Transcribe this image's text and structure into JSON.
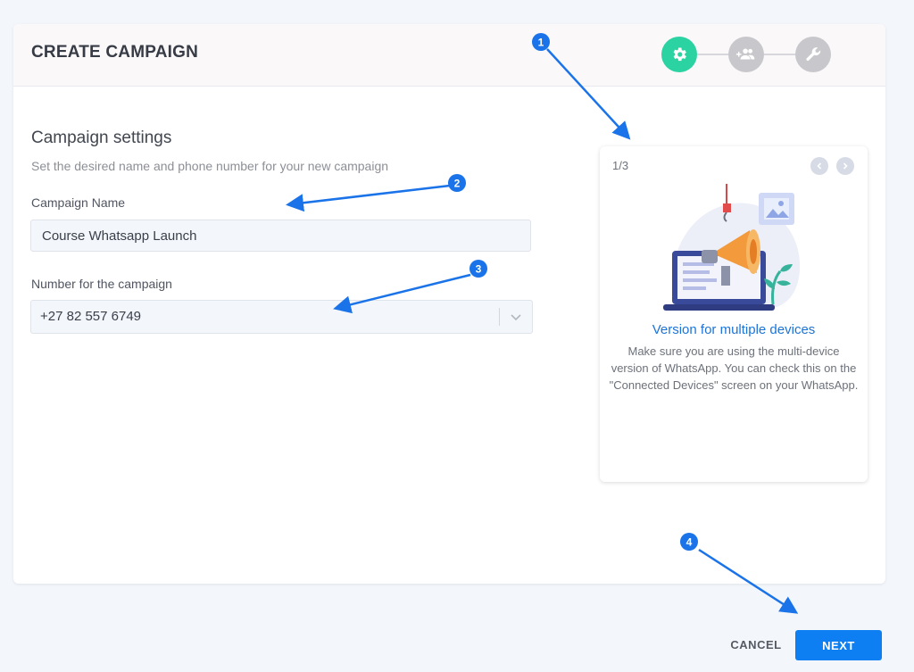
{
  "header": {
    "title": "CREATE CAMPAIGN",
    "steps": [
      {
        "icon": "gear-icon",
        "active": true
      },
      {
        "icon": "add-group-icon",
        "active": false
      },
      {
        "icon": "wrench-icon",
        "active": false
      }
    ]
  },
  "form": {
    "section_title": "Campaign settings",
    "section_subtitle": "Set the desired name and phone number for your new campaign",
    "campaign_name_label": "Campaign Name",
    "campaign_name_value": "Course Whatsapp Launch",
    "number_label": "Number for the campaign",
    "number_value": "+27 82 557 6749"
  },
  "info_panel": {
    "counter": "1/3",
    "heading": "Version for multiple devices",
    "body": "Make sure you are using the multi-device version of WhatsApp. You can check this on the \"Connected Devices\" screen on your WhatsApp."
  },
  "footer": {
    "cancel_label": "CANCEL",
    "next_label": "NEXT"
  },
  "callouts": [
    "1",
    "2",
    "3",
    "4"
  ],
  "colors": {
    "accent": "#0d7ff2",
    "step_active": "#2bd3a2",
    "step_inactive": "#c8c8cc",
    "link": "#1b74d8",
    "annotation": "#1a73e8"
  }
}
